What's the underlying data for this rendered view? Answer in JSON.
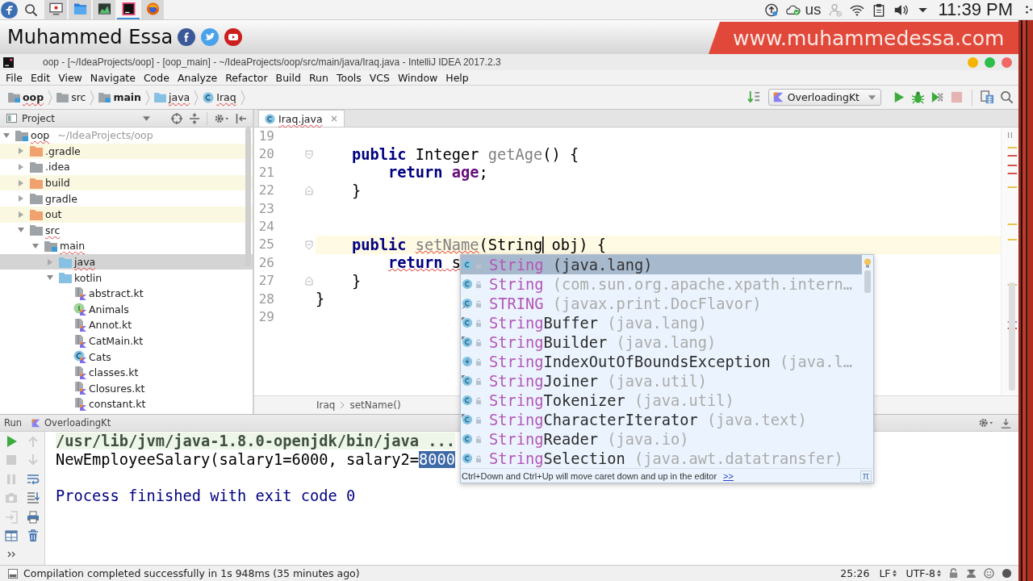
{
  "os_bar": {
    "apps": [
      {
        "kind": "recorder",
        "selected": false
      },
      {
        "kind": "files",
        "selected": false
      },
      {
        "kind": "monitor",
        "selected": false
      },
      {
        "kind": "ide",
        "selected": true
      },
      {
        "kind": "browser",
        "selected": false
      }
    ],
    "keyboard": "us",
    "clock": "11:39 PM"
  },
  "banner": {
    "name": "Muhammed Essa",
    "website": "www.muhammedessa.com"
  },
  "window": {
    "title": "oop - [~/IdeaProjects/oop] - [oop_main] - ~/IdeaProjects/oop/src/main/java/Iraq.java - IntelliJ IDEA 2017.2.3"
  },
  "menu": [
    "File",
    "Edit",
    "View",
    "Navigate",
    "Code",
    "Analyze",
    "Refactor",
    "Build",
    "Run",
    "Tools",
    "VCS",
    "Window",
    "Help"
  ],
  "navigation": {
    "breadcrumbs": [
      {
        "label": "oop",
        "kind": "module",
        "typo": true
      },
      {
        "label": "src",
        "kind": "folder",
        "typo": false
      },
      {
        "label": "main",
        "kind": "module",
        "typo": false
      },
      {
        "label": "java",
        "kind": "source-folder",
        "typo": true
      },
      {
        "label": "Iraq",
        "kind": "class",
        "typo": true
      }
    ],
    "run_config": "OverloadingKt",
    "actions": [
      {
        "kind": "run",
        "disabled": false
      },
      {
        "kind": "debug",
        "disabled": false
      },
      {
        "kind": "coverage",
        "disabled": false
      },
      {
        "kind": "stop",
        "disabled": true
      }
    ]
  },
  "project": {
    "title": "Project",
    "tree": [
      {
        "label": "oop",
        "path": "~/IdeaProjects/oop",
        "kind": "module",
        "typo": true,
        "expanded": true,
        "selected": false,
        "children": [
          {
            "label": ".gradle",
            "kind": "excluded-folder",
            "typo": false,
            "expanded": false,
            "selected": false
          },
          {
            "label": ".idea",
            "kind": "folder",
            "typo": false,
            "expanded": false,
            "selected": false
          },
          {
            "label": "build",
            "kind": "excluded-folder",
            "typo": false,
            "expanded": false,
            "selected": false
          },
          {
            "label": "gradle",
            "kind": "folder",
            "typo": false,
            "expanded": false,
            "selected": false
          },
          {
            "label": "out",
            "kind": "excluded-folder",
            "typo": false,
            "expanded": false,
            "selected": false
          },
          {
            "label": "src",
            "kind": "folder",
            "typo": true,
            "expanded": true,
            "selected": false,
            "children": [
              {
                "label": "main",
                "kind": "module",
                "typo": true,
                "expanded": true,
                "selected": false,
                "children": [
                  {
                    "label": "java",
                    "kind": "source-folder",
                    "typo": true,
                    "expanded": false,
                    "selected": true
                  },
                  {
                    "label": "kotlin",
                    "kind": "source-folder",
                    "typo": false,
                    "expanded": true,
                    "selected": false,
                    "children": [
                      {
                        "label": "abstract.kt",
                        "kind": "kotlin-file",
                        "typo": false,
                        "selected": false
                      },
                      {
                        "label": "Animals",
                        "kind": "kotlin-interface",
                        "typo": false,
                        "selected": false
                      },
                      {
                        "label": "Annot.kt",
                        "kind": "kotlin-file",
                        "typo": false,
                        "selected": false
                      },
                      {
                        "label": "CatMain.kt",
                        "kind": "kotlin-file",
                        "typo": false,
                        "selected": false
                      },
                      {
                        "label": "Cats",
                        "kind": "kotlin-class",
                        "typo": false,
                        "selected": false
                      },
                      {
                        "label": "classes.kt",
                        "kind": "kotlin-file",
                        "typo": false,
                        "selected": false
                      },
                      {
                        "label": "Closures.kt",
                        "kind": "kotlin-file",
                        "typo": false,
                        "selected": false
                      },
                      {
                        "label": "constant.kt",
                        "kind": "kotlin-file",
                        "typo": false,
                        "selected": false
                      }
                    ]
                  }
                ]
              }
            ]
          }
        ]
      }
    ]
  },
  "editor": {
    "tabs": [
      {
        "label": "Iraq.java",
        "selected": true,
        "typo": true
      }
    ],
    "lines": [
      {
        "number": "19",
        "current": false,
        "fold_start": false,
        "fold_end": false
      },
      {
        "number": "20",
        "current": false,
        "fold_start": true,
        "fold_end": false,
        "code": [
          {
            "text": "    public ",
            "kind": "keyword",
            "error": false
          },
          {
            "text": "Integer ",
            "kind": "plain",
            "error": false
          },
          {
            "text": "getAge",
            "kind": "unused",
            "error": false
          },
          {
            "text": "() {",
            "kind": "plain",
            "error": false
          }
        ]
      },
      {
        "number": "21",
        "current": false,
        "fold_start": false,
        "fold_end": false,
        "code": [
          {
            "text": "        return ",
            "kind": "keyword",
            "error": false
          },
          {
            "text": "age",
            "kind": "field",
            "error": false
          },
          {
            "text": ";",
            "kind": "plain",
            "error": false
          }
        ]
      },
      {
        "number": "22",
        "current": false,
        "fold_start": false,
        "fold_end": true,
        "code": [
          {
            "text": "    }",
            "kind": "plain",
            "error": false
          }
        ]
      },
      {
        "number": "23",
        "current": false,
        "fold_start": false,
        "fold_end": false
      },
      {
        "number": "24",
        "current": false,
        "fold_start": false,
        "fold_end": false
      },
      {
        "number": "25",
        "current": true,
        "fold_start": true,
        "fold_end": false,
        "code": [
          {
            "text": "    public ",
            "kind": "keyword",
            "error": false
          },
          {
            "text": "setName",
            "kind": "unused",
            "error": true
          },
          {
            "text": "(String",
            "kind": "plain",
            "error": false
          },
          {
            "kind": "caret"
          },
          {
            "text": " obj) {",
            "kind": "plain",
            "error": false
          }
        ]
      },
      {
        "number": "26",
        "current": false,
        "fold_start": false,
        "fold_end": false,
        "code": [
          {
            "text": "        return",
            "kind": "keyword",
            "error": true
          },
          {
            "text": " s",
            "kind": "plain",
            "error": true
          }
        ]
      },
      {
        "number": "27",
        "current": false,
        "fold_start": false,
        "fold_end": true,
        "code": [
          {
            "text": "    }",
            "kind": "plain",
            "error": false
          }
        ]
      },
      {
        "number": "28",
        "current": false,
        "fold_start": false,
        "fold_end": false,
        "code": [
          {
            "text": "}",
            "kind": "plain",
            "error": false
          }
        ]
      },
      {
        "number": "29",
        "current": false,
        "fold_start": false,
        "fold_end": false
      }
    ],
    "breadcrumbs": [
      "Iraq",
      "setName()"
    ]
  },
  "completion": {
    "items": [
      {
        "kind": "class",
        "match": "String",
        "package": "(java.lang)",
        "selected": true
      },
      {
        "kind": "class",
        "match": "String",
        "package": "(com.sun.org.apache.xpath.intern…",
        "selected": false
      },
      {
        "kind": "field",
        "match": "STRING",
        "package": "(javax.print.DocFlavor)",
        "selected": false
      },
      {
        "kind": "final-class",
        "match": "String",
        "rest": "Buffer",
        "package": "(java.lang)",
        "selected": false
      },
      {
        "kind": "final-class",
        "match": "String",
        "rest": "Builder",
        "package": "(java.lang)",
        "selected": false
      },
      {
        "kind": "exception",
        "match": "String",
        "rest": "IndexOutOfBoundsException",
        "package": "(java.l…",
        "selected": false
      },
      {
        "kind": "final-class",
        "match": "String",
        "rest": "Joiner",
        "package": "(java.util)",
        "selected": false
      },
      {
        "kind": "class",
        "match": "String",
        "rest": "Tokenizer",
        "package": "(java.util)",
        "selected": false
      },
      {
        "kind": "final-class",
        "match": "String",
        "rest": "CharacterIterator",
        "package": "(java.text)",
        "selected": false
      },
      {
        "kind": "class",
        "match": "String",
        "rest": "Reader",
        "package": "(java.io)",
        "selected": false
      },
      {
        "kind": "class",
        "match": "String",
        "rest": "Selection",
        "package": "(java.awt.datatransfer)",
        "selected": false
      }
    ],
    "hint": "Ctrl+Down and Ctrl+Up will move caret down and up in the editor",
    "hint_link": ">>",
    "corner_button": "π"
  },
  "run": {
    "title": "Run",
    "tab": "OverloadingKt",
    "toolbar": [
      {
        "tools": [
          {
            "kind": "rerun",
            "disabled": false
          },
          {
            "kind": "stop",
            "disabled": true
          },
          {
            "kind": "pause",
            "disabled": true
          },
          {
            "kind": "dump",
            "disabled": true
          },
          {
            "kind": "exit",
            "disabled": true
          },
          {
            "kind": "layout",
            "disabled": false
          },
          {
            "kind": "more",
            "disabled": false
          }
        ]
      },
      {
        "tools": [
          {
            "kind": "up",
            "disabled": true
          },
          {
            "kind": "down",
            "disabled": true
          },
          {
            "kind": "wrap",
            "disabled": false
          },
          {
            "kind": "scroll-end",
            "disabled": false
          },
          {
            "kind": "print",
            "disabled": false
          },
          {
            "kind": "clear",
            "disabled": false
          }
        ]
      }
    ],
    "console": [
      {
        "kind": "command",
        "segments": [
          {
            "text": "/usr/lib/jvm/java-1.8.0-openjdk/bin/java ...",
            "selected": false
          }
        ]
      },
      {
        "kind": "output",
        "segments": [
          {
            "text": "NewEmployeeSalary(salary1=6000, salary2=",
            "selected": false
          },
          {
            "text": "8000",
            "selected": true
          }
        ]
      },
      {
        "kind": "exit",
        "segments": [
          {
            "text": "Process finished with exit code 0",
            "selected": false
          }
        ]
      }
    ]
  },
  "status_bar": {
    "message": "Compilation completed successfully in 1s 948ms (35 minutes ago)",
    "caret_position": "25:26",
    "line_separator": "LF",
    "encoding": "UTF-8"
  }
}
